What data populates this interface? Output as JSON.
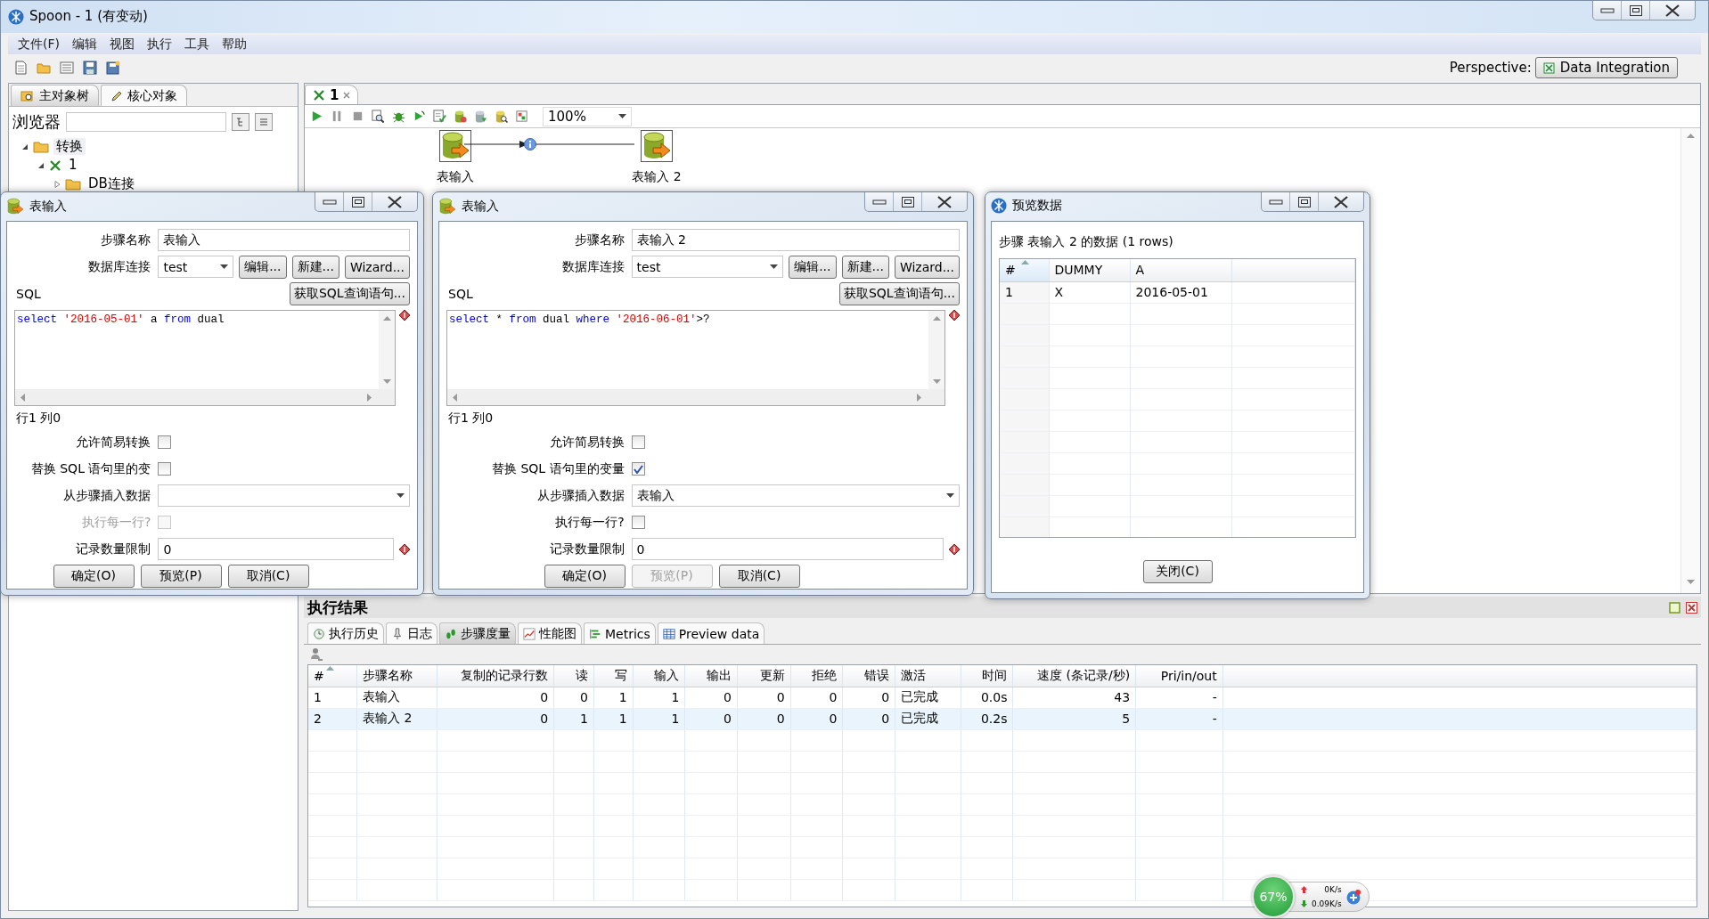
{
  "window": {
    "title": "Spoon - 1 (有变动)"
  },
  "menu": [
    "文件(F)",
    "编辑",
    "视图",
    "执行",
    "工具",
    "帮助"
  ],
  "perspective": {
    "label": "Perspective:",
    "value": "Data Integration"
  },
  "explorer": {
    "tabs": [
      {
        "label": "主对象树",
        "selected": true
      },
      {
        "label": "核心对象",
        "selected": false
      }
    ],
    "search_label": "浏览器",
    "tree": [
      {
        "label": "转换",
        "kind": "folder",
        "expanded": true,
        "selected": true,
        "children": [
          {
            "label": "1",
            "kind": "transformation",
            "expanded": true,
            "selected": false,
            "children": [
              {
                "label": "DB连接",
                "kind": "folder",
                "expanded": false,
                "selected": false
              }
            ]
          }
        ]
      }
    ]
  },
  "editor": {
    "tab": "1",
    "zoom": "100%",
    "steps": [
      {
        "label": "表输入"
      },
      {
        "label": "表输入 2"
      }
    ]
  },
  "step_dialogs": [
    {
      "title": "表输入",
      "step_name_label": "步骤名称",
      "step_name": "表输入",
      "connection_label": "数据库连接",
      "connection": "test",
      "connection_buttons": [
        "编辑...",
        "新建...",
        "Wizard..."
      ],
      "sql_label": "SQL",
      "get_sql_button": "获取SQL查询语句...",
      "sql": [
        {
          "text": "select",
          "kind": "keyword"
        },
        {
          "text": " '2016-05-01'",
          "kind": "string"
        },
        {
          "text": " a ",
          "kind": "plain"
        },
        {
          "text": "from",
          "kind": "keyword"
        },
        {
          "text": " dual",
          "kind": "plain"
        }
      ],
      "cursor_position": "行1 列0",
      "options": [
        {
          "label": "允许简易转换",
          "checked": false,
          "disabled": false
        },
        {
          "label": "替换 SQL 语句里的变",
          "checked": false,
          "disabled": false
        }
      ],
      "insert_from_label": "从步骤插入数据",
      "execute_each_row": {
        "label": "执行每一行?",
        "checked": false,
        "disabled": true
      },
      "limit_label": "记录数量限制",
      "limit": "0",
      "actions": [
        {
          "label": "确定(O)",
          "disabled": false
        },
        {
          "label": "预览(P)",
          "disabled": false
        },
        {
          "label": "取消(C)",
          "disabled": false
        }
      ]
    },
    {
      "title": "表输入",
      "step_name_label": "步骤名称",
      "step_name": "表输入 2",
      "connection_label": "数据库连接",
      "connection": "test",
      "connection_buttons": [
        "编辑...",
        "新建...",
        "Wizard..."
      ],
      "sql_label": "SQL",
      "get_sql_button": "获取SQL查询语句...",
      "sql": [
        {
          "text": "select",
          "kind": "keyword"
        },
        {
          "text": " * ",
          "kind": "plain"
        },
        {
          "text": "from",
          "kind": "keyword"
        },
        {
          "text": " dual ",
          "kind": "plain"
        },
        {
          "text": "where",
          "kind": "keyword"
        },
        {
          "text": " '2016-06-01'",
          "kind": "string"
        },
        {
          "text": ">?",
          "kind": "plain"
        }
      ],
      "cursor_position": "行1 列0",
      "options": [
        {
          "label": "允许简易转换",
          "checked": false,
          "disabled": false
        },
        {
          "label": "替换 SQL 语句里的变量",
          "checked": true,
          "disabled": false
        }
      ],
      "insert_from_label": "从步骤插入数据",
      "insert_from": "表输入",
      "execute_each_row": {
        "label": "执行每一行?",
        "checked": false,
        "disabled": false
      },
      "limit_label": "记录数量限制",
      "limit": "0",
      "actions": [
        {
          "label": "确定(O)",
          "disabled": false
        },
        {
          "label": "预览(P)",
          "disabled": true
        },
        {
          "label": "取消(C)",
          "disabled": false
        }
      ]
    }
  ],
  "preview": {
    "title": "预览数据",
    "caption": "步骤 表输入 2 的数据  (1 rows)",
    "columns": [
      "#",
      "DUMMY",
      "A"
    ],
    "rows": [
      [
        "1",
        "X",
        "2016-05-01"
      ]
    ],
    "close_button": "关闭(C)"
  },
  "results": {
    "title": "执行结果",
    "tabs": [
      {
        "label": "执行历史",
        "selected": false
      },
      {
        "label": "日志",
        "selected": false
      },
      {
        "label": "步骤度量",
        "selected": true
      },
      {
        "label": "性能图",
        "selected": false
      },
      {
        "label": "Metrics",
        "selected": false
      },
      {
        "label": "Preview data",
        "selected": false
      }
    ],
    "columns": [
      "#",
      "步骤名称",
      "复制的记录行数",
      "读",
      "写",
      "输入",
      "输出",
      "更新",
      "拒绝",
      "错误",
      "激活",
      "时间",
      "速度 (条记录/秒)",
      "Pri/in/out"
    ],
    "rows": [
      {
        "cells": [
          "1",
          "表输入",
          "0",
          "0",
          "1",
          "1",
          "0",
          "0",
          "0",
          "0",
          "已完成",
          "0.0s",
          "43",
          "-"
        ],
        "selected": false
      },
      {
        "cells": [
          "2",
          "表输入 2",
          "0",
          "1",
          "1",
          "1",
          "0",
          "0",
          "0",
          "0",
          "已完成",
          "0.2s",
          "5",
          "-"
        ],
        "selected": true
      }
    ]
  },
  "network": {
    "usage": "67%",
    "upload": "0K/s",
    "download": "0.09K/s"
  }
}
